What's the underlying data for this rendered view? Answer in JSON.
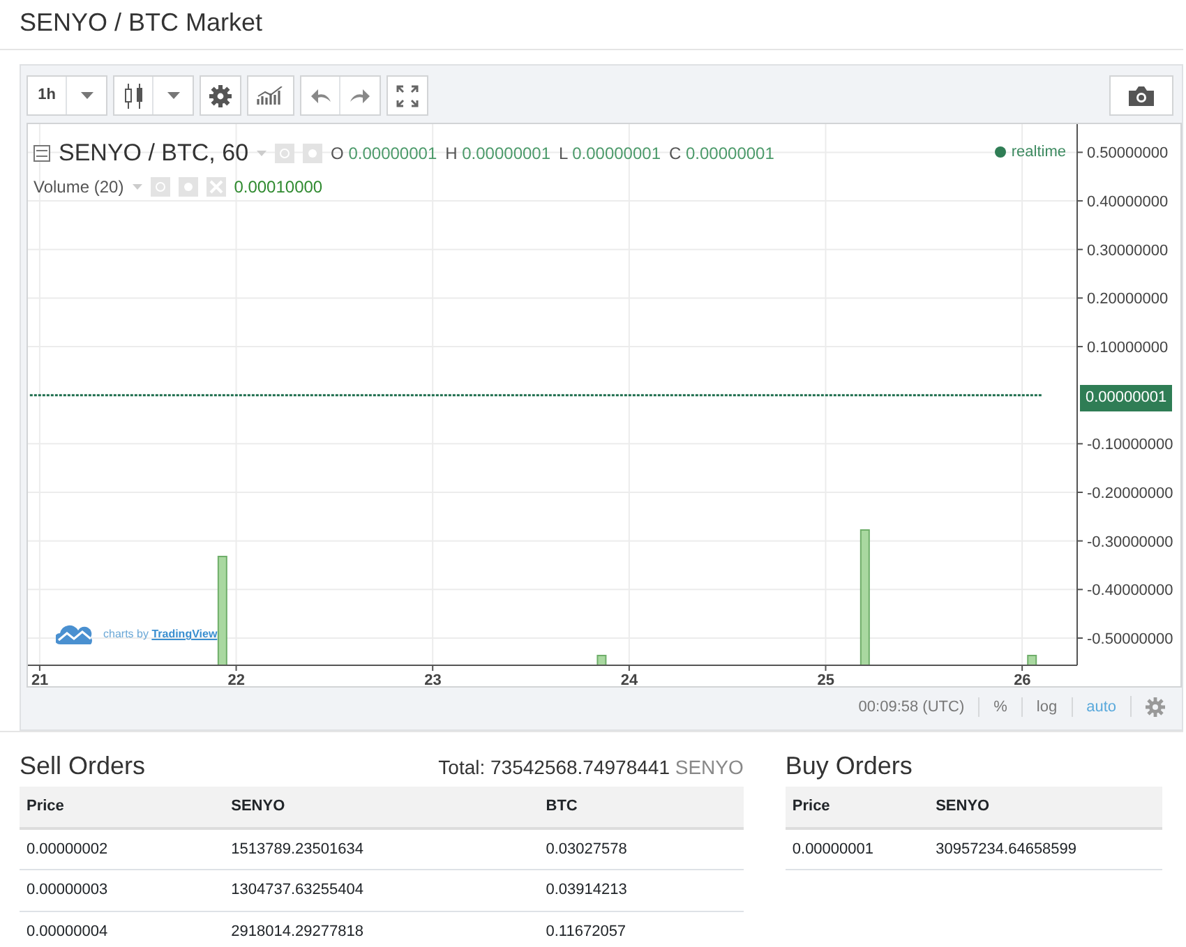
{
  "page_title": "SENYO / BTC Market",
  "chart_widget": {
    "toolbar": [
      {
        "kind": "interval",
        "label": "1h"
      },
      {
        "kind": "caret"
      },
      {
        "kind": "candles"
      },
      {
        "kind": "caret"
      },
      {
        "kind": "gear"
      },
      {
        "kind": "indicators"
      },
      {
        "kind": "undo"
      },
      {
        "kind": "redo"
      },
      {
        "kind": "fullscreen"
      },
      {
        "kind": "camera"
      }
    ],
    "legend": {
      "symbol": "SENYO / BTC, 60",
      "ohlc": [
        {
          "key": "O",
          "value": "0.00000001"
        },
        {
          "key": "H",
          "value": "0.00000001"
        },
        {
          "key": "L",
          "value": "0.00000001"
        },
        {
          "key": "C",
          "value": "0.00000001"
        }
      ],
      "volume_label": "Volume (20)",
      "volume_value": "0.00010000",
      "status": "realtime"
    },
    "attribution": {
      "text": "charts by",
      "link": "TradingView"
    },
    "last_price": "0.00000001",
    "chart_data": {
      "type": "line",
      "x": [
        20.95,
        26.1
      ],
      "series": [
        {
          "color": "#1e6e4e",
          "line_style": "dashed",
          "values": [
            1e-08,
            1e-08
          ]
        }
      ],
      "grid": true,
      "xlim": [
        20.94,
        26.28
      ],
      "ylim": [
        -0.556,
        0.558
      ],
      "xticks": [
        21,
        22,
        23,
        24,
        25,
        26
      ],
      "yticks": [
        {
          "value": 0.5,
          "label": "0.50000000"
        },
        {
          "value": 0.4,
          "label": "0.40000000"
        },
        {
          "value": 0.3,
          "label": "0.30000000"
        },
        {
          "value": 0.2,
          "label": "0.20000000"
        },
        {
          "value": 0.1,
          "label": "0.10000000"
        },
        {
          "value": -0.1,
          "label": "-0.10000000"
        },
        {
          "value": -0.2,
          "label": "-0.20000000"
        },
        {
          "value": -0.3,
          "label": "-0.30000000"
        },
        {
          "value": -0.4,
          "label": "-0.40000000"
        },
        {
          "value": -0.5,
          "label": "-0.50000000"
        }
      ]
    },
    "bottom_bar": {
      "time": "00:09:58 (UTC)",
      "options": [
        {
          "label": "%",
          "selected": false
        },
        {
          "label": "log",
          "selected": false
        },
        {
          "label": "auto",
          "selected": true
        }
      ]
    }
  },
  "sell_orders": {
    "title": "Sell Orders",
    "total_label": "Total:",
    "total_value": "73542568.74978441",
    "total_unit": "SENYO",
    "columns": [
      "Price",
      "SENYO",
      "BTC"
    ],
    "rows": [
      [
        "0.00000002",
        "1513789.23501634",
        "0.03027578"
      ],
      [
        "0.00000003",
        "1304737.63255404",
        "0.03914213"
      ],
      [
        "0.00000004",
        "2918014.29277818",
        "0.11672057"
      ]
    ]
  },
  "buy_orders": {
    "title": "Buy Orders",
    "columns": [
      "Price",
      "SENYO"
    ],
    "rows": [
      [
        "0.00000001",
        "30957234.64658599"
      ]
    ]
  }
}
